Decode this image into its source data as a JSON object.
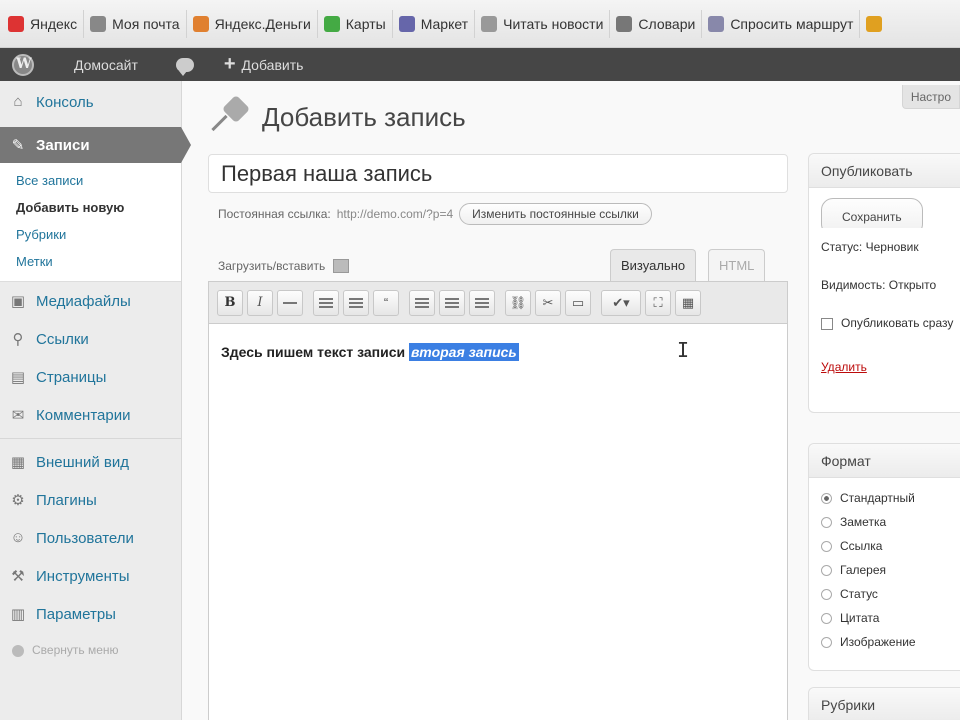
{
  "bookmarks": [
    {
      "label": "Яндекс",
      "color": "#d33"
    },
    {
      "label": "Моя почта",
      "color": "#888"
    },
    {
      "label": "Яндекс.Деньги",
      "color": "#e08030"
    },
    {
      "label": "Карты",
      "color": "#4a4"
    },
    {
      "label": "Маркет",
      "color": "#66a"
    },
    {
      "label": "Читать новости",
      "color": "#999"
    },
    {
      "label": "Словари",
      "color": "#777"
    },
    {
      "label": "Спросить маршрут",
      "color": "#88a"
    },
    {
      "label": "",
      "color": "#e0a020"
    }
  ],
  "adminbar": {
    "site_name": "Домосайт",
    "add_label": "Добавить"
  },
  "sidebar": {
    "console": "Консоль",
    "posts": "Записи",
    "posts_sub": [
      "Все записи",
      "Добавить новую",
      "Рубрики",
      "Метки"
    ],
    "menu_group1": [
      {
        "label": "Медиафайлы",
        "icon": "▣"
      },
      {
        "label": "Ссылки",
        "icon": "⚲"
      },
      {
        "label": "Страницы",
        "icon": "▤"
      },
      {
        "label": "Комментарии",
        "icon": "✉"
      }
    ],
    "menu_group2": [
      {
        "label": "Внешний вид",
        "icon": "▦"
      },
      {
        "label": "Плагины",
        "icon": "⚙"
      },
      {
        "label": "Пользователи",
        "icon": "☺"
      },
      {
        "label": "Инструменты",
        "icon": "⚒"
      },
      {
        "label": "Параметры",
        "icon": "▥"
      }
    ],
    "collapse": "Свернуть меню"
  },
  "main": {
    "screen_options": "Настро",
    "page_title": "Добавить запись",
    "post_title": "Первая наша запись",
    "permalink_label": "Постоянная ссылка:",
    "permalink_url": "http://demo.com/?p=4",
    "permalink_button": "Изменить постоянные ссылки",
    "upload_label": "Загрузить/вставить",
    "tab_visual": "Визуально",
    "tab_html": "HTML",
    "content_text": "Здесь пишем текст записи",
    "content_selected": "вторая запись"
  },
  "publish": {
    "title": "Опубликовать",
    "save": "Сохранить",
    "status": "Статус: Черновик",
    "visibility": "Видимость: Открыто",
    "publish_now": "Опубликовать сразу",
    "delete": "Удалить"
  },
  "format": {
    "title": "Формат",
    "options": [
      "Стандартный",
      "Заметка",
      "Ссылка",
      "Галерея",
      "Статус",
      "Цитата",
      "Изображение"
    ]
  },
  "categories": {
    "title": "Рубрики"
  }
}
